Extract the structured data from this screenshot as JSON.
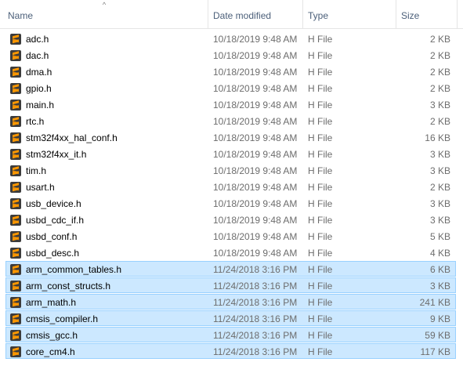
{
  "columns": {
    "name": "Name",
    "date_modified": "Date modified",
    "type": "Type",
    "size": "Size"
  },
  "sort_indicator": "^",
  "files": [
    {
      "name": "adc.h",
      "date": "10/18/2019 9:48 AM",
      "type": "H File",
      "size": "2 KB",
      "selected": false
    },
    {
      "name": "dac.h",
      "date": "10/18/2019 9:48 AM",
      "type": "H File",
      "size": "2 KB",
      "selected": false
    },
    {
      "name": "dma.h",
      "date": "10/18/2019 9:48 AM",
      "type": "H File",
      "size": "2 KB",
      "selected": false
    },
    {
      "name": "gpio.h",
      "date": "10/18/2019 9:48 AM",
      "type": "H File",
      "size": "2 KB",
      "selected": false
    },
    {
      "name": "main.h",
      "date": "10/18/2019 9:48 AM",
      "type": "H File",
      "size": "3 KB",
      "selected": false
    },
    {
      "name": "rtc.h",
      "date": "10/18/2019 9:48 AM",
      "type": "H File",
      "size": "2 KB",
      "selected": false
    },
    {
      "name": "stm32f4xx_hal_conf.h",
      "date": "10/18/2019 9:48 AM",
      "type": "H File",
      "size": "16 KB",
      "selected": false
    },
    {
      "name": "stm32f4xx_it.h",
      "date": "10/18/2019 9:48 AM",
      "type": "H File",
      "size": "3 KB",
      "selected": false
    },
    {
      "name": "tim.h",
      "date": "10/18/2019 9:48 AM",
      "type": "H File",
      "size": "3 KB",
      "selected": false
    },
    {
      "name": "usart.h",
      "date": "10/18/2019 9:48 AM",
      "type": "H File",
      "size": "2 KB",
      "selected": false
    },
    {
      "name": "usb_device.h",
      "date": "10/18/2019 9:48 AM",
      "type": "H File",
      "size": "3 KB",
      "selected": false
    },
    {
      "name": "usbd_cdc_if.h",
      "date": "10/18/2019 9:48 AM",
      "type": "H File",
      "size": "3 KB",
      "selected": false
    },
    {
      "name": "usbd_conf.h",
      "date": "10/18/2019 9:48 AM",
      "type": "H File",
      "size": "5 KB",
      "selected": false
    },
    {
      "name": "usbd_desc.h",
      "date": "10/18/2019 9:48 AM",
      "type": "H File",
      "size": "4 KB",
      "selected": false
    },
    {
      "name": "arm_common_tables.h",
      "date": "11/24/2018 3:16 PM",
      "type": "H File",
      "size": "6 KB",
      "selected": true
    },
    {
      "name": "arm_const_structs.h",
      "date": "11/24/2018 3:16 PM",
      "type": "H File",
      "size": "3 KB",
      "selected": true
    },
    {
      "name": "arm_math.h",
      "date": "11/24/2018 3:16 PM",
      "type": "H File",
      "size": "241 KB",
      "selected": true
    },
    {
      "name": "cmsis_compiler.h",
      "date": "11/24/2018 3:16 PM",
      "type": "H File",
      "size": "9 KB",
      "selected": true
    },
    {
      "name": "cmsis_gcc.h",
      "date": "11/24/2018 3:16 PM",
      "type": "H File",
      "size": "59 KB",
      "selected": true
    },
    {
      "name": "core_cm4.h",
      "date": "11/24/2018 3:16 PM",
      "type": "H File",
      "size": "117 KB",
      "selected": true
    }
  ],
  "icon": "sublime-text-file-icon",
  "colors": {
    "selection_bg": "#cce8ff",
    "selection_border": "#99d1ff",
    "header_text": "#4c607a",
    "secondary_text": "#6d6d6d",
    "icon_orange": "#ff9800",
    "icon_dark": "#3c3c3c"
  }
}
